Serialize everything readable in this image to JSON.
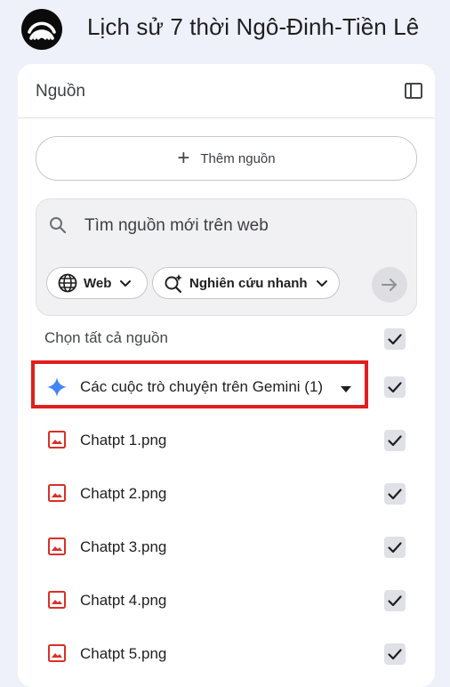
{
  "header": {
    "notebook_title": "Lịch sử 7 thời Ngô-Đinh-Tiền Lê"
  },
  "sources_panel": {
    "title": "Nguồn",
    "add_source_label": "Thêm nguồn",
    "search": {
      "placeholder": "Tìm nguồn mới trên web"
    },
    "chips": {
      "web_label": "Web",
      "research_label": "Nghiên cứu nhanh"
    },
    "select_all_label": "Chọn tất cả nguồn",
    "gemini_source": {
      "label": "Các cuộc trò chuyện trên Gemini (1)",
      "checked": true
    },
    "sources": [
      {
        "label": "Chatpt 1.png",
        "icon": "image-icon",
        "checked": true
      },
      {
        "label": "Chatpt 2.png",
        "icon": "image-icon",
        "checked": true
      },
      {
        "label": "Chatpt 3.png",
        "icon": "image-icon",
        "checked": true
      },
      {
        "label": "Chatpt 4.png",
        "icon": "image-icon",
        "checked": true
      },
      {
        "label": "Chatpt 5.png",
        "icon": "image-icon",
        "checked": true
      }
    ]
  },
  "colors": {
    "page_background": "#eef0fa",
    "image_icon": "#d93025",
    "gemini_icon": "#4285f4",
    "highlight_border": "#e21d1d",
    "checkbox_fill": "#dfe1e7"
  }
}
